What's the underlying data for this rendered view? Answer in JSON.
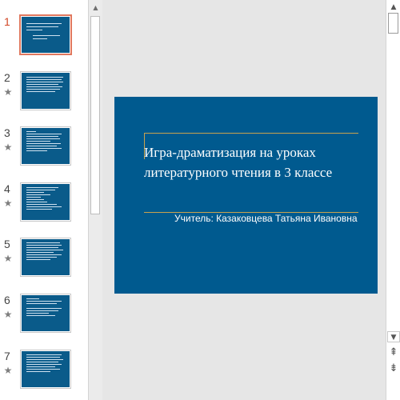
{
  "thumbnails": [
    {
      "number": "1",
      "active": true,
      "has_animation_star": false
    },
    {
      "number": "2",
      "active": false,
      "has_animation_star": true
    },
    {
      "number": "3",
      "active": false,
      "has_animation_star": true
    },
    {
      "number": "4",
      "active": false,
      "has_animation_star": true
    },
    {
      "number": "5",
      "active": false,
      "has_animation_star": true
    },
    {
      "number": "6",
      "active": false,
      "has_animation_star": true
    },
    {
      "number": "7",
      "active": false,
      "has_animation_star": true
    }
  ],
  "icons": {
    "star": "★",
    "scroll_up": "▲",
    "scroll_down": "▼",
    "prev_slide": "⇞",
    "next_slide": "⇟"
  },
  "slide": {
    "title": "Игра-драматизация на уроках литературного чтения в 3 классе",
    "subtitle": "Учитель: Казаковцева Татьяна Ивановна"
  },
  "colors": {
    "slide_background": "#005a8f",
    "accent_line": "#c8a24e",
    "active_slide_number": "#d24726",
    "active_thumbnail_border": "#e0785e"
  }
}
